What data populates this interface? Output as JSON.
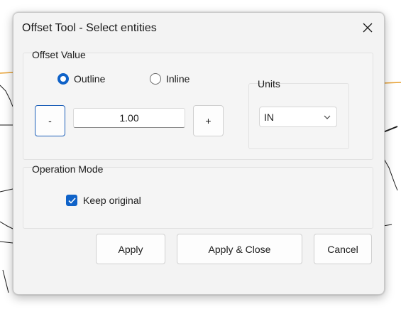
{
  "dialog": {
    "title": "Offset Tool - Select entities",
    "close_icon": "close-icon"
  },
  "offset_value": {
    "group_label": "Offset Value",
    "radio_outline": {
      "label": "Outline",
      "checked": true
    },
    "radio_inline": {
      "label": "Inline",
      "checked": false
    },
    "decrement_label": "-",
    "value": "1.00",
    "increment_label": "+"
  },
  "units": {
    "group_label": "Units",
    "selected": "IN",
    "dropdown_icon": "chevron-down-icon"
  },
  "operation_mode": {
    "group_label": "Operation Mode",
    "keep_original": {
      "label": "Keep original",
      "checked": true
    }
  },
  "footer": {
    "apply_label": "Apply",
    "apply_close_label": "Apply & Close",
    "cancel_label": "Cancel"
  },
  "colors": {
    "accent": "#0f62c8",
    "dialog_bg": "#f3f3f3",
    "background_line_orange": "#e8a030"
  }
}
